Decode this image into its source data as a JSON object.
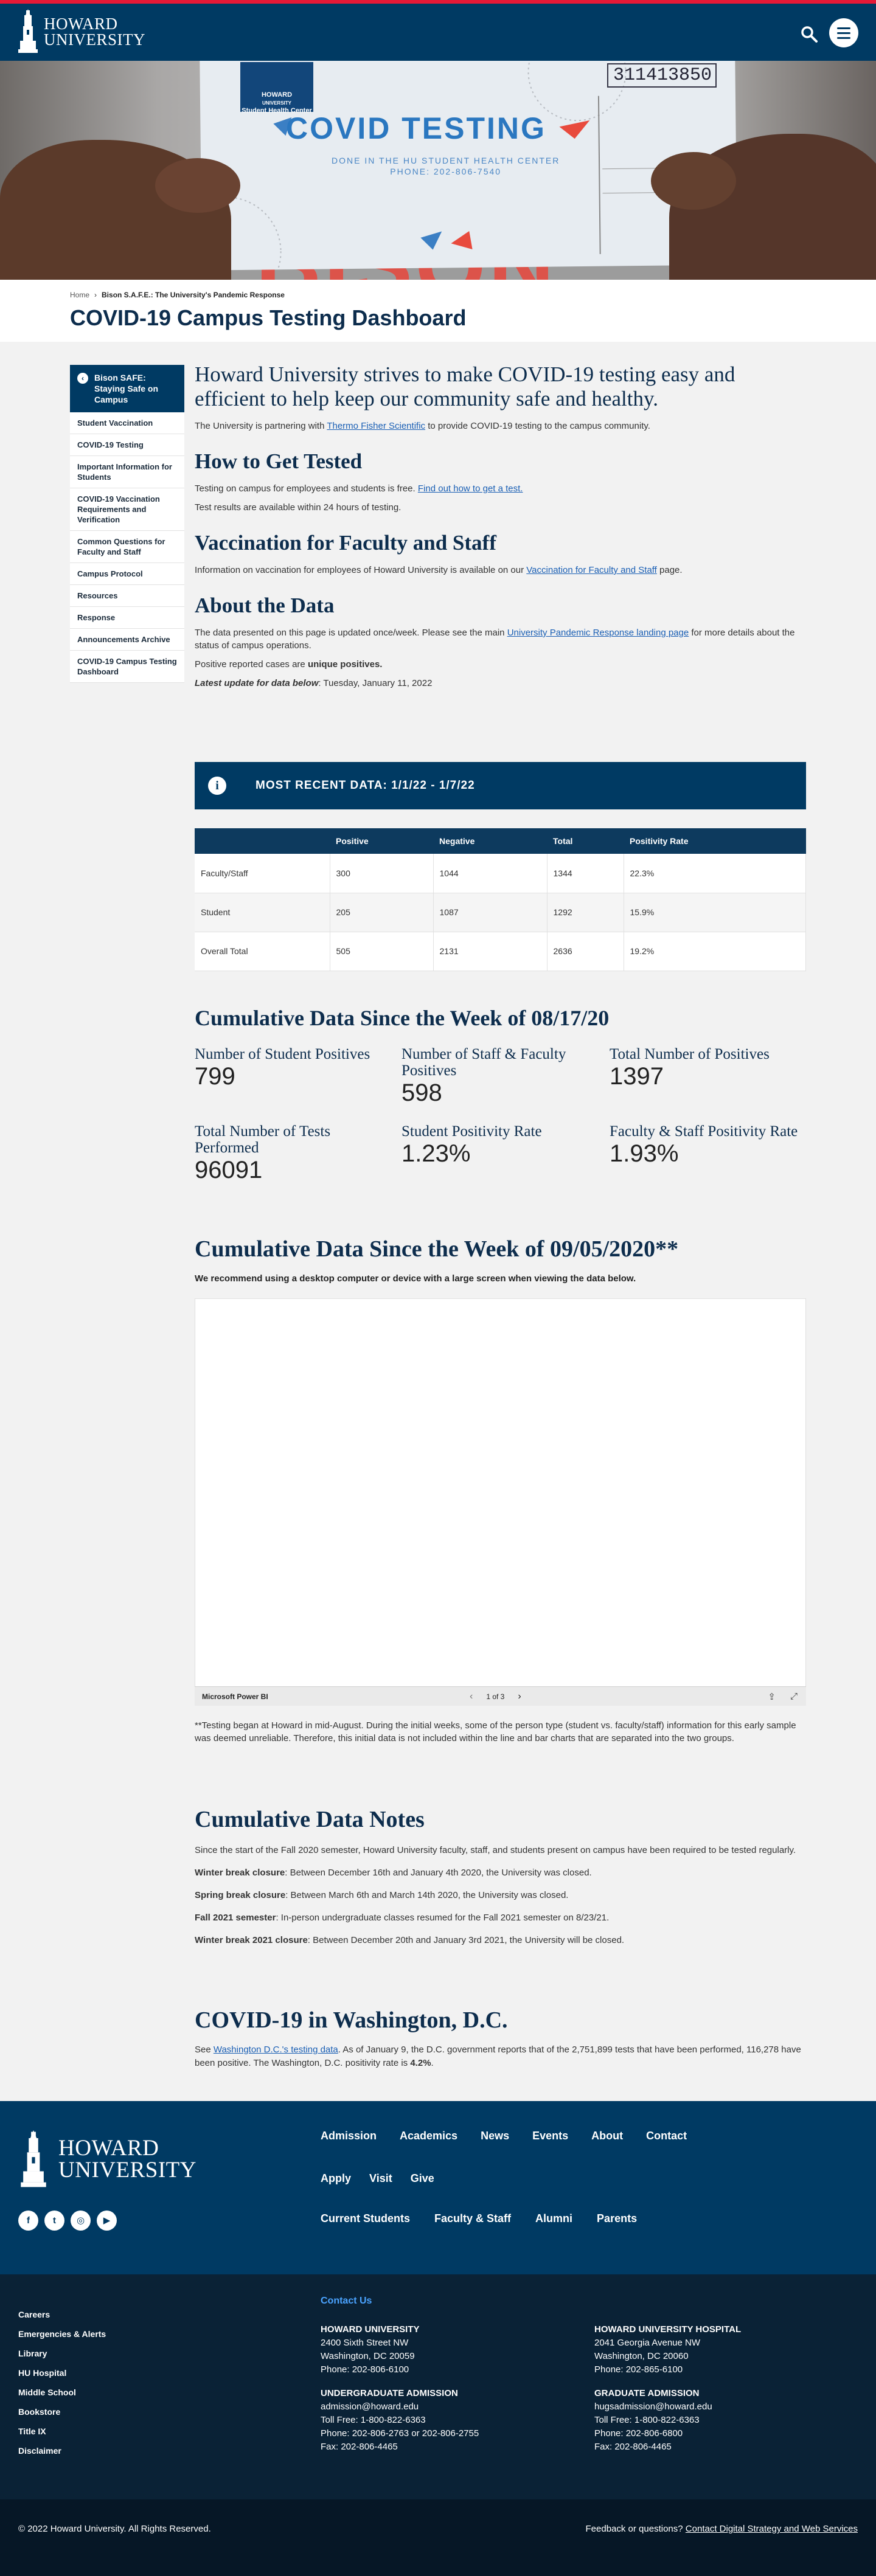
{
  "header": {
    "logo_line1": "HOWARD",
    "logo_line2": "UNIVERSITY",
    "icons": [
      "search-icon",
      "menu-icon"
    ]
  },
  "hero": {
    "badge_line1": "HOWARD",
    "badge_line2": "UNIVERSITY",
    "badge_line3": "Student Health Center",
    "card_title": "COVID TESTING",
    "card_sub1": "DONE IN THE HU STUDENT HEALTH CENTER",
    "card_sub2": "PHONE: 202-806-7540",
    "stamp": "311413850",
    "shirt": "BISON"
  },
  "breadcrumb": {
    "home": "Home",
    "current": "Bison S.A.F.E.: The University's Pandemic Response"
  },
  "page_title": "COVID-19 Campus Testing Dashboard",
  "sidebar": {
    "active": "Bison SAFE: Staying Safe on Campus",
    "items": [
      "Student Vaccination",
      "COVID-19 Testing",
      "Important Information for Students",
      "COVID-19 Vaccination Requirements and Verification",
      "Common Questions for Faculty and Staff",
      "Campus Protocol",
      "Resources",
      "Response",
      "Announcements Archive",
      "COVID-19 Campus Testing Dashboard"
    ]
  },
  "intro": {
    "lead": "Howard University strives to make COVID-19 testing easy and efficient to help keep our community safe and healthy.",
    "partner_pre": "The University is partnering with ",
    "partner_link": "Thermo Fisher Scientific",
    "partner_post": " to provide COVID-19 testing to the campus community."
  },
  "how": {
    "title": "How to Get Tested",
    "p1_pre": "Testing on campus for employees and students is free. ",
    "p1_link": "Find out how to get a test.",
    "p2": "Test results are available within 24 hours of testing."
  },
  "vacc": {
    "title": "Vaccination for Faculty and Staff",
    "pre": "Information on vaccination for employees of Howard University is available on our ",
    "link": "Vaccination for Faculty and Staff",
    "post": " page."
  },
  "about": {
    "title": "About the Data",
    "p1_pre": "The data presented on this page is updated once/week. Please see the main ",
    "p1_link": "University Pandemic Response landing page",
    "p1_post": " for more details about the status of campus operations.",
    "p2_pre": "Positive reported cases are ",
    "p2_bold": "unique positives.",
    "p3_bold": "Latest update for data below",
    "p3_post": ": Tuesday, January 11, 2022"
  },
  "recent": {
    "banner": "MOST RECENT DATA: 1/1/22 - 1/7/22",
    "headers": [
      "",
      "Positive",
      "Negative",
      "Total",
      "Positivity Rate"
    ],
    "rows": [
      [
        "Faculty/Staff",
        "300",
        "1044",
        "1344",
        "22.3%"
      ],
      [
        "Student",
        "205",
        "1087",
        "1292",
        "15.9%"
      ],
      [
        "Overall Total",
        "505",
        "2131",
        "2636",
        "19.2%"
      ]
    ]
  },
  "cumulative": {
    "title": "Cumulative Data Since the Week of 08/17/20",
    "stats": [
      {
        "label": "Number of Student Positives",
        "value": "799"
      },
      {
        "label": "Number of Staff & Faculty Positives",
        "value": "598"
      },
      {
        "label": "Total Number of Positives",
        "value": "1397"
      },
      {
        "label": "Total Number of Tests Performed",
        "value": "96091"
      },
      {
        "label": "Student Positivity Rate",
        "value": "1.23%"
      },
      {
        "label": "Faculty & Staff Positivity Rate",
        "value": "1.93%"
      }
    ]
  },
  "cumulative2": {
    "title": "Cumulative Data Since the Week of 09/05/2020**",
    "note": "We recommend using a desktop computer or device with a large screen when viewing the data below.",
    "embed_brand": "Microsoft Power BI",
    "pager": "1 of 3",
    "footnote": "**Testing began at Howard in mid-August. During the initial weeks, some of the person type (student vs. faculty/staff) information for this early sample was deemed unreliable. Therefore, this initial data is not included within the line and bar charts that are separated into the two groups."
  },
  "notes": {
    "title": "Cumulative Data Notes",
    "intro": "Since the start of the Fall 2020 semester, Howard University faculty, staff, and students present on campus have been required to be tested regularly.",
    "items": [
      {
        "label": "Winter break closure",
        "text": ": Between December 16th and January 4th 2020, the University was closed."
      },
      {
        "label": "Spring break closure",
        "text": ": Between March 6th and March 14th 2020, the University was closed."
      },
      {
        "label": "Fall 2021 semester",
        "text": ": In-person undergraduate classes resumed for the Fall 2021 semester on 8/23/21."
      },
      {
        "label": "Winter break 2021 closure",
        "text": ": Between December 20th and January 3rd 2021, the University will be closed."
      }
    ]
  },
  "dc": {
    "title": "COVID-19 in Washington, D.C.",
    "pre": "See ",
    "link": "Washington D.C.'s testing data",
    "mid": ". As of January 9, the D.C. government reports that of the 2,751,899 tests that have been performed, 116,278 have been positive. The Washington, D.C. positivity rate is ",
    "rate": "4.2%",
    "post": "."
  },
  "footer": {
    "logo_line1": "HOWARD",
    "logo_line2": "UNIVERSITY",
    "nav1": [
      "Admission",
      "Academics",
      "News",
      "Events",
      "About",
      "Contact"
    ],
    "nav2": [
      "Apply",
      "Visit",
      "Give"
    ],
    "nav3": [
      "Current Students",
      "Faculty & Staff",
      "Alumni",
      "Parents"
    ],
    "socials": [
      "facebook-icon",
      "twitter-icon",
      "instagram-icon",
      "youtube-icon"
    ],
    "links": [
      "Careers",
      "Emergencies & Alerts",
      "Library",
      "HU Hospital",
      "Middle School",
      "Bookstore",
      "Title IX",
      "Disclaimer"
    ],
    "contact_us": "Contact Us",
    "hu": {
      "name": "HOWARD UNIVERSITY",
      "l1": "2400 Sixth Street NW",
      "l2": "Washington, DC 20059",
      "l3": "Phone: 202-806-6100"
    },
    "hosp": {
      "name": "HOWARD UNIVERSITY HOSPITAL",
      "l1": "2041 Georgia Avenue NW",
      "l2": "Washington, DC 20060",
      "l3": "Phone: 202-865-6100"
    },
    "ug": {
      "name": "UNDERGRADUATE ADMISSION",
      "l1": "admission@howard.edu",
      "l2": "Toll Free: 1-800-822-6363",
      "l3": "Phone: 202-806-2763 or 202-806-2755",
      "l4": "Fax: 202-806-4465"
    },
    "grad": {
      "name": "GRADUATE ADMISSION",
      "l1": "hugsadmission@howard.edu",
      "l2": "Toll Free: 1-800-822-6363",
      "l3": "Phone: 202-806-6800",
      "l4": "Fax: 202-806-4465"
    },
    "copyright": "© 2022 Howard University. All Rights Reserved.",
    "feedback_pre": "Feedback or questions? ",
    "feedback_link": "Contact Digital Strategy and Web Services"
  }
}
